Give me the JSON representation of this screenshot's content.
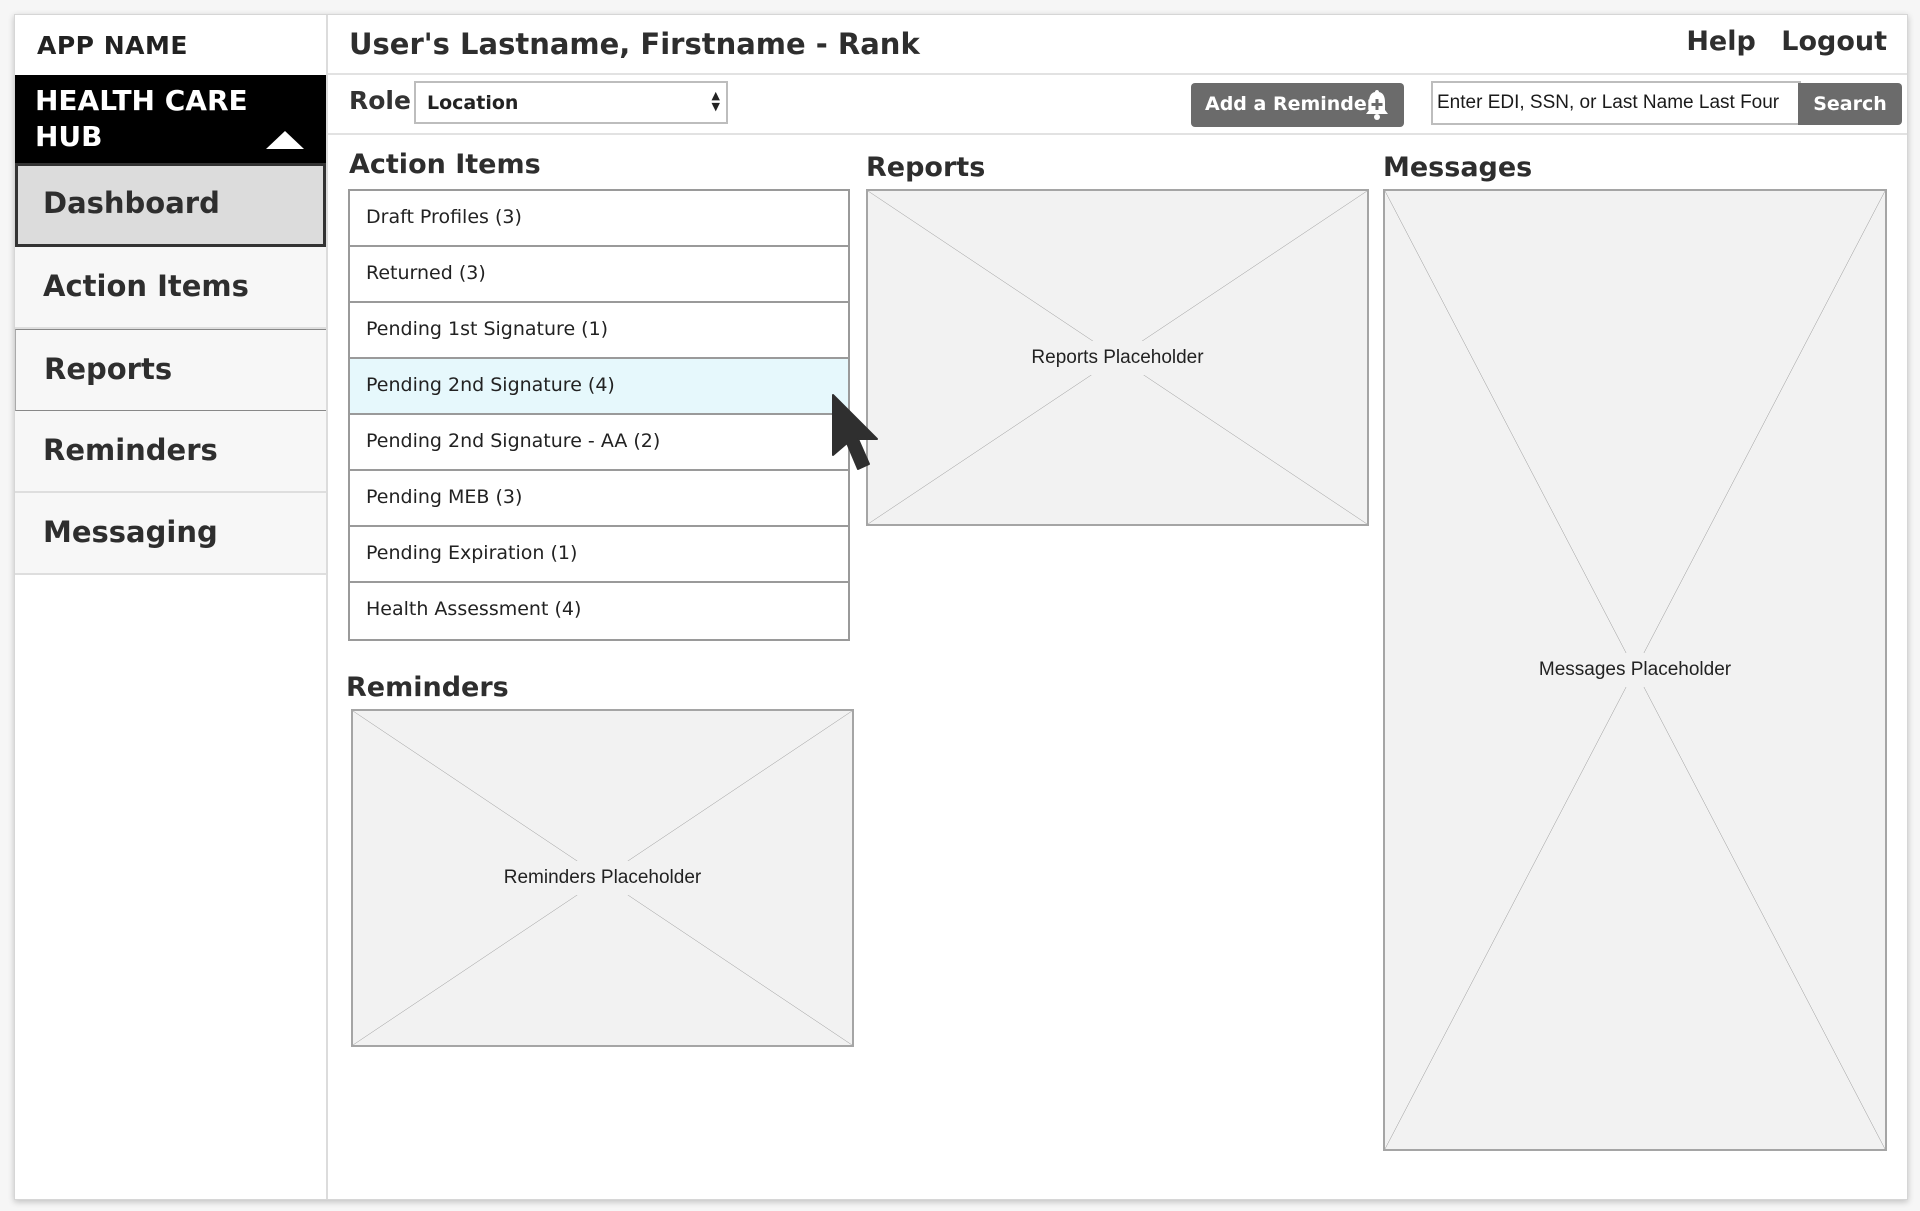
{
  "app": {
    "name": "APP NAME",
    "hub_title": "HEALTH CARE HUB"
  },
  "sidebar": {
    "items": [
      {
        "label": "Dashboard",
        "active": true
      },
      {
        "label": "Action Items",
        "active": false
      },
      {
        "label": "Reports",
        "active": false
      },
      {
        "label": "Reminders",
        "active": false
      },
      {
        "label": "Messaging",
        "active": false
      }
    ]
  },
  "header": {
    "user": "User's Lastname, Firstname - Rank",
    "links": {
      "help": "Help",
      "logout": "Logout"
    }
  },
  "toolbar": {
    "role_label": "Role",
    "role_value": "Location",
    "add_reminder_label": "Add a Reminder",
    "search_placeholder": "Enter EDI, SSN, or Last Name Last Four",
    "search_value": "",
    "search_button": "Search"
  },
  "action_items": {
    "title": "Action Items",
    "rows": [
      {
        "label": "Draft Profiles (3)"
      },
      {
        "label": "Returned (3)"
      },
      {
        "label": "Pending 1st Signature (1)"
      },
      {
        "label": "Pending 2nd Signature (4)",
        "selected": true
      },
      {
        "label": "Pending 2nd Signature - AA (2)"
      },
      {
        "label": "Pending MEB (3)"
      },
      {
        "label": "Pending Expiration (1)"
      },
      {
        "label": "Health Assessment (4)"
      }
    ]
  },
  "reports": {
    "title": "Reports",
    "placeholder": "Reports Placeholder"
  },
  "messages": {
    "title": "Messages",
    "placeholder": "Messages Placeholder"
  },
  "reminders": {
    "title": "Reminders",
    "placeholder": "Reminders Placeholder"
  },
  "colors": {
    "hub_bg": "#000000",
    "button_bg": "#6b6b6b",
    "selected_row": "#e6f8fc",
    "placeholder_bg": "#f2f2f2"
  }
}
